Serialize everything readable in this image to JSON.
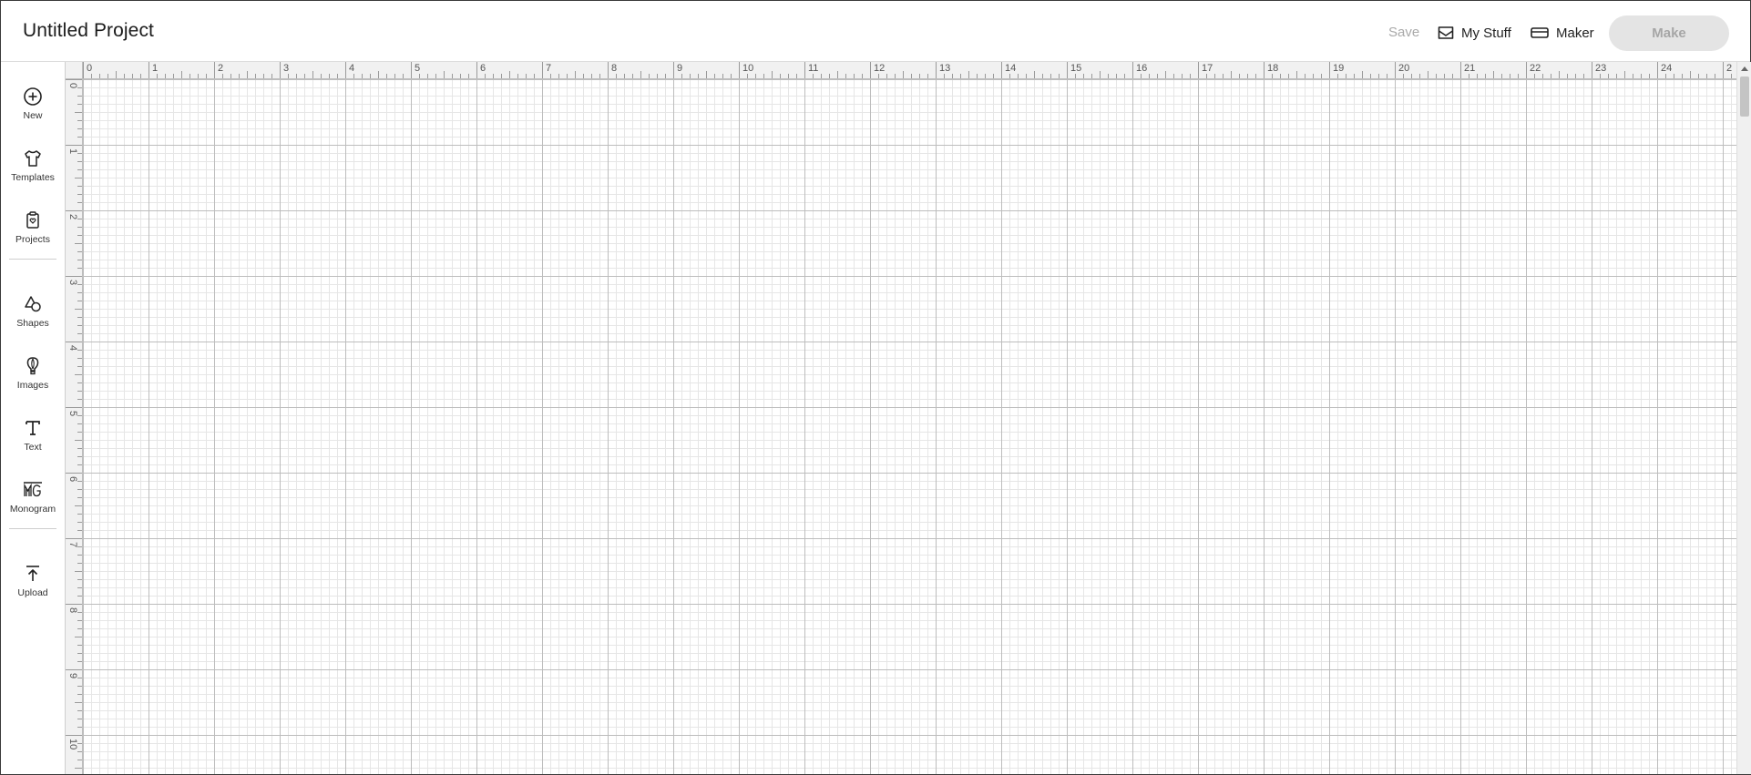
{
  "header": {
    "title": "Untitled Project",
    "save_label": "Save",
    "my_stuff_label": "My Stuff",
    "maker_label": "Maker",
    "make_label": "Make"
  },
  "sidebar": {
    "items": [
      {
        "label": "New",
        "icon": "plus-circle-icon"
      },
      {
        "label": "Templates",
        "icon": "shirt-icon"
      },
      {
        "label": "Projects",
        "icon": "clipboard-heart-icon"
      },
      {
        "label": "Shapes",
        "icon": "shapes-icon"
      },
      {
        "label": "Images",
        "icon": "lightbulb-icon"
      },
      {
        "label": "Text",
        "icon": "text-t-icon"
      },
      {
        "label": "Monogram",
        "icon": "monogram-icon"
      },
      {
        "label": "Upload",
        "icon": "upload-icon"
      }
    ]
  },
  "ruler": {
    "top_labels": [
      "0",
      "1",
      "2",
      "3",
      "4",
      "5",
      "6",
      "7",
      "8",
      "9",
      "10",
      "11",
      "12",
      "13",
      "14",
      "15",
      "16",
      "17",
      "18",
      "19",
      "20",
      "21",
      "22",
      "23",
      "24",
      "2"
    ],
    "left_labels": [
      "0",
      "1",
      "2",
      "3",
      "4",
      "5",
      "6",
      "7",
      "8",
      "9",
      "10"
    ]
  },
  "colors": {
    "accent_disabled": "#e4e4e4",
    "grid_major": "#bdbdbd",
    "grid_minor": "#e6e6e6"
  }
}
